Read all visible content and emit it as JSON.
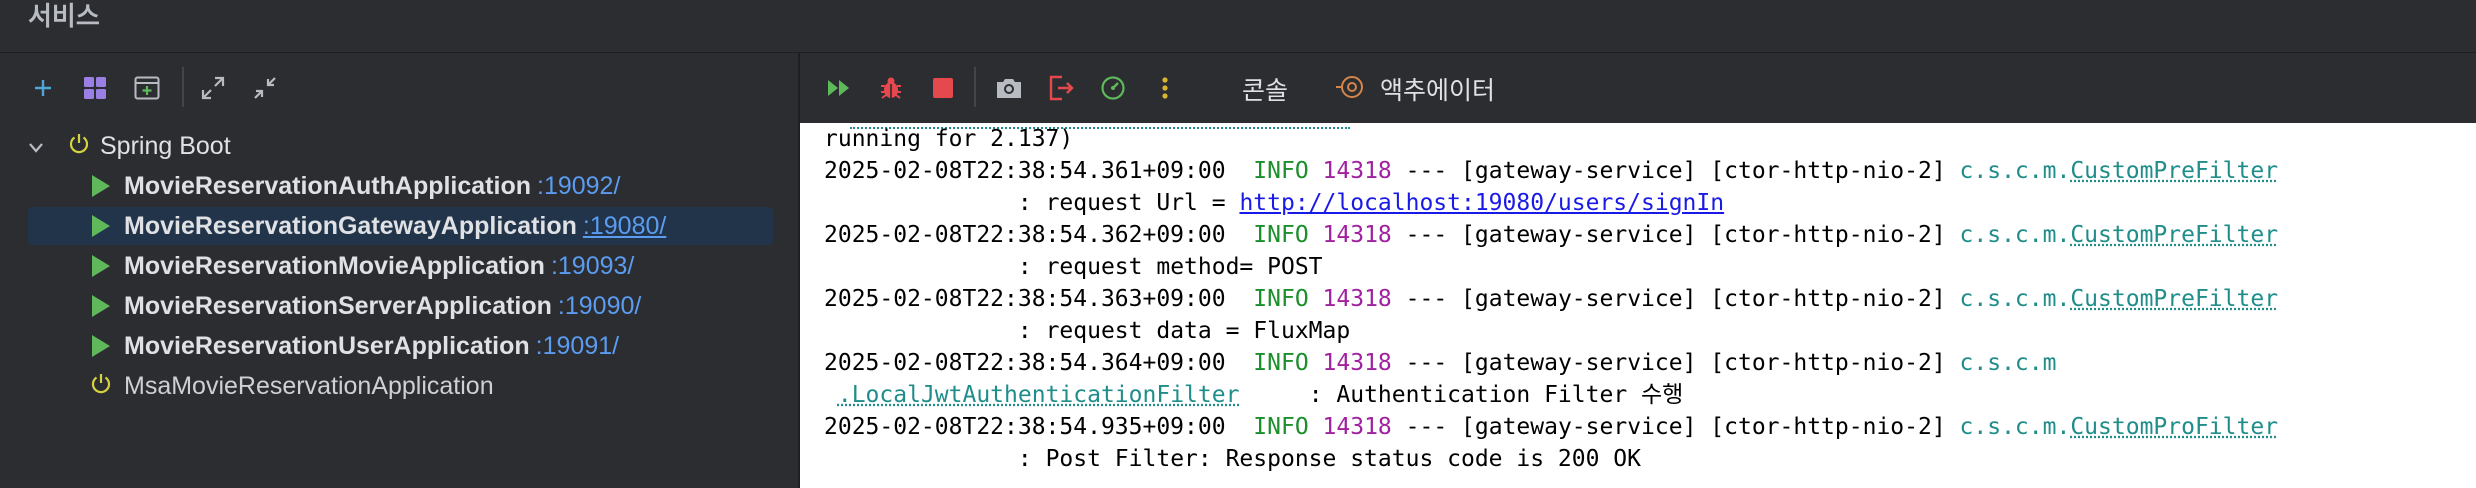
{
  "title": "서비스",
  "left_toolbar": {
    "icons": [
      "add-icon",
      "group-icon",
      "new-tab-icon",
      "expand-all-icon",
      "collapse-all-icon"
    ]
  },
  "tree": {
    "root_label": "Spring Boot",
    "apps": [
      {
        "name": "MovieReservationAuthApplication",
        "port": ":19092/",
        "running": true,
        "selected": false
      },
      {
        "name": "MovieReservationGatewayApplication",
        "port": ":19080/",
        "running": true,
        "selected": true
      },
      {
        "name": "MovieReservationMovieApplication",
        "port": ":19093/",
        "running": true,
        "selected": false
      },
      {
        "name": "MovieReservationServerApplication",
        "port": ":19090/",
        "running": true,
        "selected": false
      },
      {
        "name": "MovieReservationUserApplication",
        "port": ":19091/",
        "running": true,
        "selected": false
      }
    ],
    "inactive_app": "MsaMovieReservationApplication"
  },
  "right_toolbar": {
    "icons": [
      "rerun-icon",
      "debug-icon",
      "stop-icon",
      "camera-icon",
      "exit-icon",
      "gauge-icon",
      "more-icon"
    ],
    "tab_console": "콘솔",
    "tab_actuator": "액추에이터"
  },
  "console": {
    "top_partial": "running for 2.137)",
    "entries": [
      {
        "timestamp": "2025-02-08T22:38:54.361+09:00",
        "level": "INFO",
        "pid": "14318",
        "middle": "--- [gateway-service] [ctor-http-nio-2]",
        "logger_prefix": "c.s.c.m.",
        "logger_name": "CustomPreFilter",
        "message_prefix": ": request Url = ",
        "message_link": "http://localhost:19080/users/signIn"
      },
      {
        "timestamp": "2025-02-08T22:38:54.362+09:00",
        "level": "INFO",
        "pid": "14318",
        "middle": "--- [gateway-service] [ctor-http-nio-2]",
        "logger_prefix": "c.s.c.m.",
        "logger_name": "CustomPreFilter",
        "message_prefix": ": request method= POST",
        "message_link": ""
      },
      {
        "timestamp": "2025-02-08T22:38:54.363+09:00",
        "level": "INFO",
        "pid": "14318",
        "middle": "--- [gateway-service] [ctor-http-nio-2]",
        "logger_prefix": "c.s.c.m.",
        "logger_name": "CustomPreFilter",
        "message_prefix": ": request data = FluxMap",
        "message_link": ""
      },
      {
        "timestamp": "2025-02-08T22:38:54.364+09:00",
        "level": "INFO",
        "pid": "14318",
        "middle": "--- [gateway-service] [ctor-http-nio-2]",
        "logger_prefix": "c.s.c.m",
        "logger_name": ".LocalJwtAuthenticationFilter",
        "message_prefix": ": Authentication Filter 수행",
        "message_link": ""
      },
      {
        "timestamp": "2025-02-08T22:38:54.935+09:00",
        "level": "INFO",
        "pid": "14318",
        "middle": "--- [gateway-service] [ctor-http-nio-2]",
        "logger_prefix": "c.s.c.m.",
        "logger_name": "CustomProFilter",
        "message_prefix": ": Post Filter: Response status code is 200 OK",
        "message_link": ""
      }
    ]
  },
  "colors": {
    "background": "#2b2d30",
    "selection": "#213449",
    "port_link": "#5b9bf0",
    "run_green": "#5fb85a",
    "spring_icon": "#d5d341",
    "stop_red": "#e5484d",
    "log_info": "#1b8f2a",
    "log_pid": "#a0219f",
    "log_logger": "#1f8d8a"
  }
}
